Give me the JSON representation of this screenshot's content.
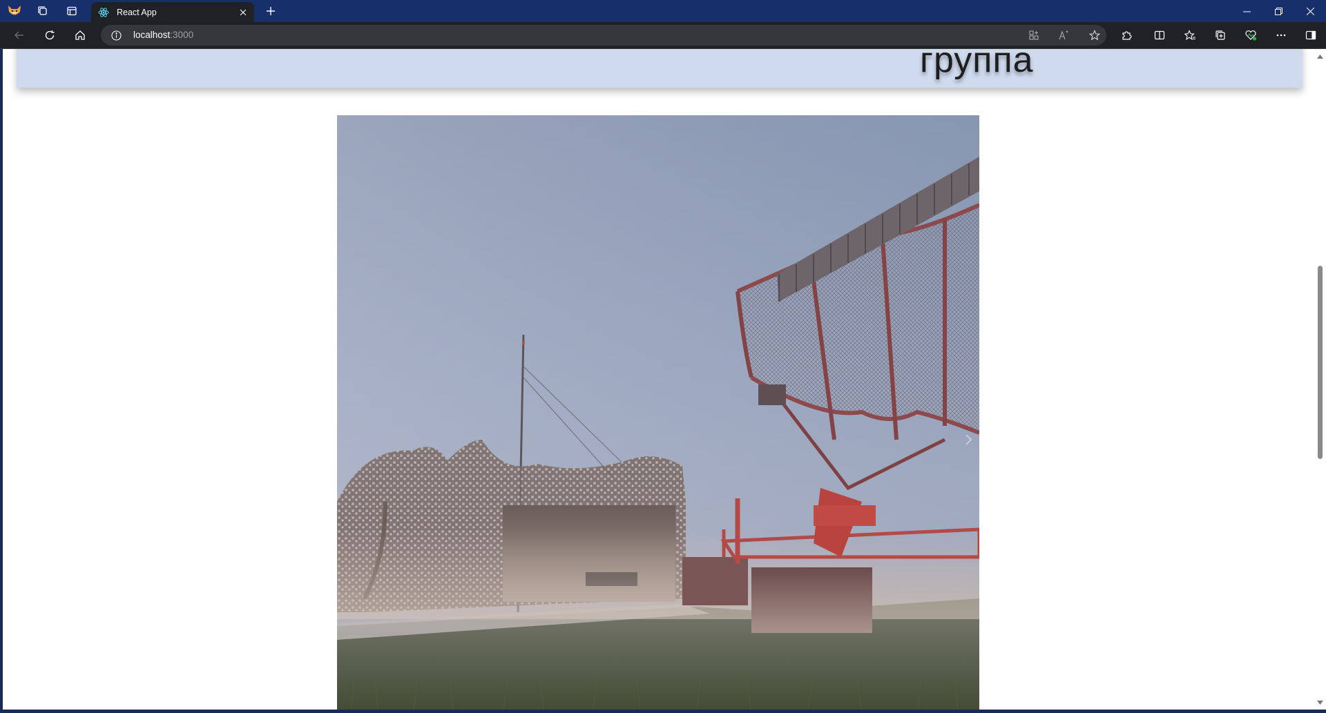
{
  "browser": {
    "tab": {
      "title": "React App",
      "favicon": "react-logo-icon"
    },
    "address": {
      "host": "localhost",
      "port": ":3000"
    },
    "icons": {
      "profile": "fox-profile-icon",
      "workspaces": "workspaces-icon",
      "vertical_tabs": "tab-actions-icon",
      "new_tab": "plus-icon",
      "back": "back-arrow-icon",
      "refresh": "refresh-icon",
      "home": "home-icon",
      "site_info": "info-icon",
      "app_available": "app-icon",
      "read_aloud": "read-aloud-icon",
      "favorite": "star-icon",
      "extensions": "puzzle-icon",
      "split_screen": "split-screen-icon",
      "favorites": "favorites-icon",
      "collections": "collections-icon",
      "browser_essentials": "heart-pulse-icon",
      "more": "more-icon",
      "sidebar": "sidebar-icon"
    },
    "window_controls": [
      "minimize",
      "restore",
      "close"
    ]
  },
  "page": {
    "header_title": "группа",
    "slider": {
      "image": "radar-station-in-fog",
      "next_icon": "chevron-right-icon"
    }
  },
  "colors": {
    "tabstrip": "#17306b",
    "toolbar": "#202124",
    "banner": "#cfdaef",
    "page_bg": "#ffffff"
  }
}
